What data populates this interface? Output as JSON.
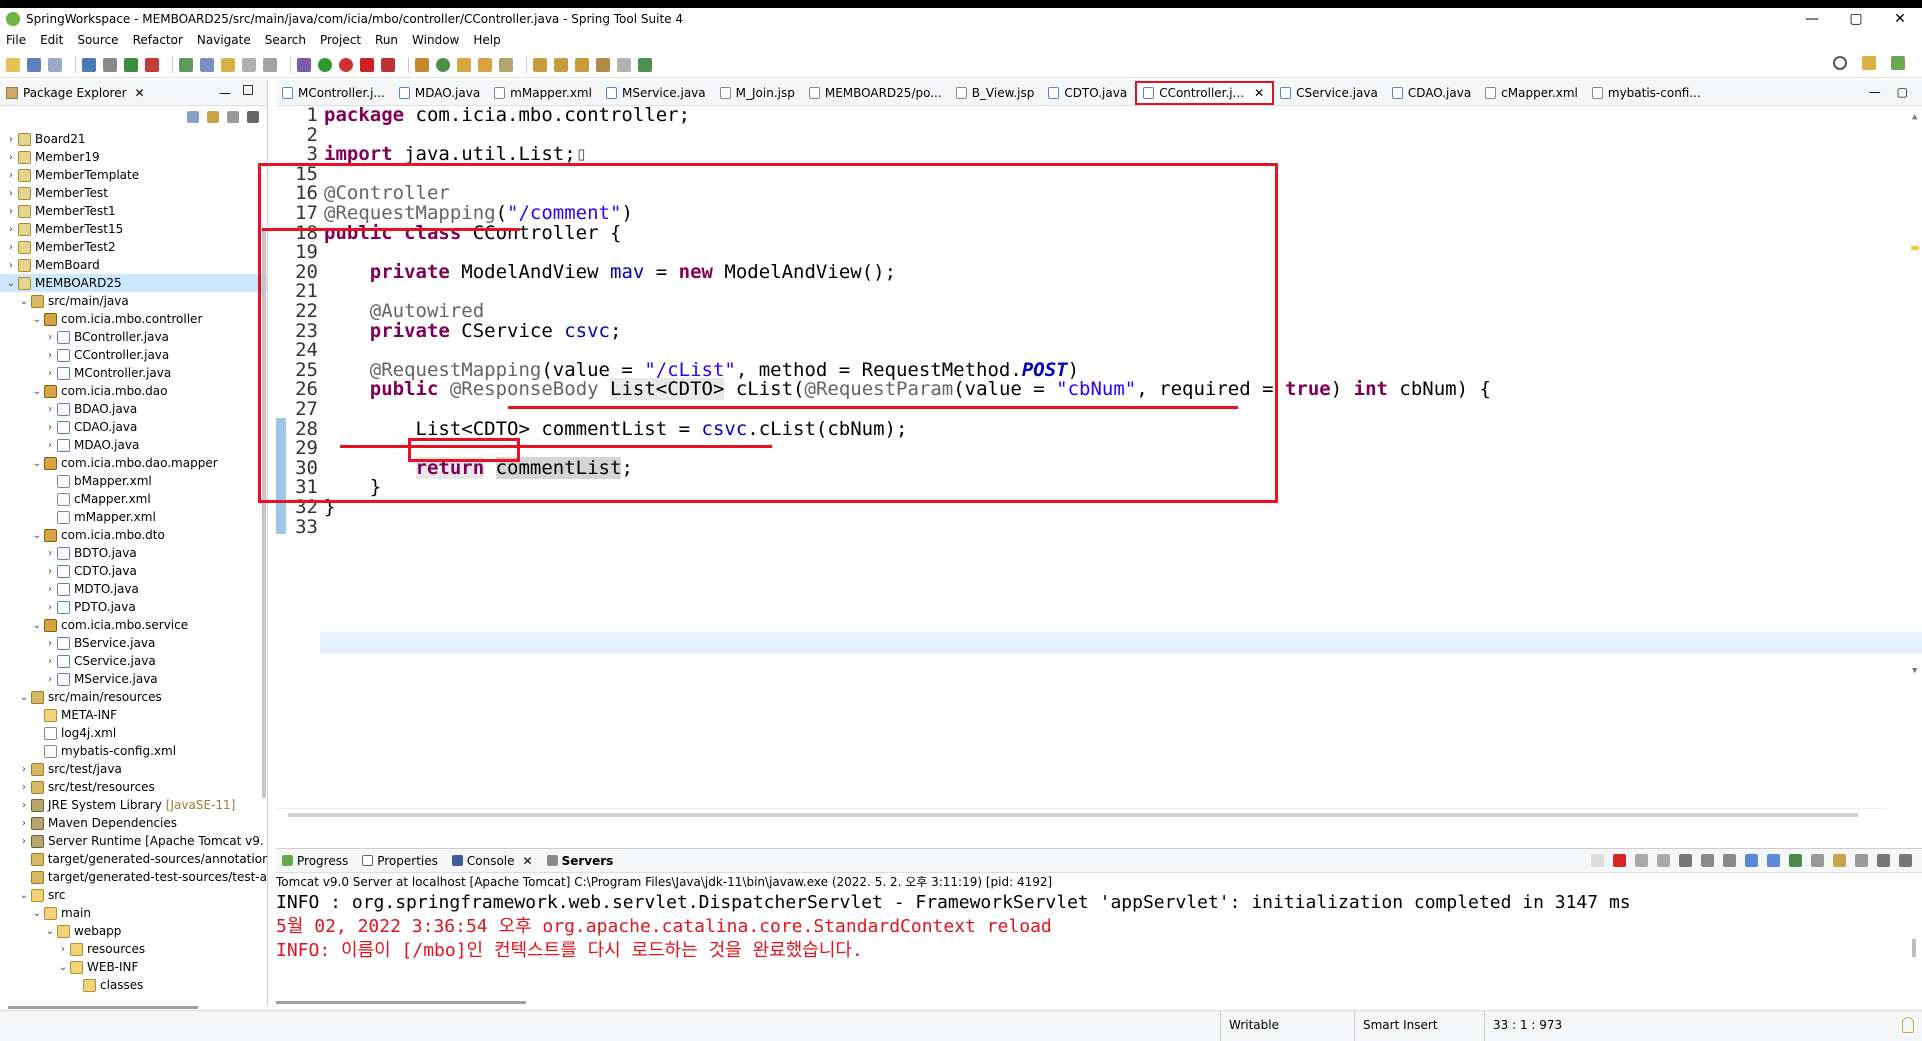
{
  "window": {
    "title": "SpringWorkspace - MEMBOARD25/src/main/java/com/icia/mbo/controller/CController.java - Spring Tool Suite 4",
    "minimize": "—",
    "maximize": "▢",
    "close": "✕"
  },
  "menu": [
    "File",
    "Edit",
    "Source",
    "Refactor",
    "Navigate",
    "Search",
    "Project",
    "Run",
    "Window",
    "Help"
  ],
  "package_explorer": {
    "tab_label": "Package Explorer",
    "tree": [
      {
        "label": "Board21",
        "icon": "project-icon",
        "twisty": "›",
        "indent": 0
      },
      {
        "label": "Member19",
        "icon": "project-icon",
        "twisty": "›",
        "indent": 0
      },
      {
        "label": "MemberTemplate",
        "icon": "project-icon",
        "twisty": "›",
        "indent": 0
      },
      {
        "label": "MemberTest",
        "icon": "project-icon",
        "twisty": "›",
        "indent": 0
      },
      {
        "label": "MemberTest1",
        "icon": "project-icon",
        "twisty": "›",
        "indent": 0
      },
      {
        "label": "MemberTest15",
        "icon": "project-icon",
        "twisty": "›",
        "indent": 0
      },
      {
        "label": "MemberTest2",
        "icon": "project-icon",
        "twisty": "›",
        "indent": 0
      },
      {
        "label": "MemBoard",
        "icon": "project-icon",
        "twisty": "›",
        "indent": 0
      },
      {
        "label": "MEMBOARD25",
        "icon": "project-icon",
        "twisty": "⌄",
        "indent": 0,
        "selected": true
      },
      {
        "label": "src/main/java",
        "icon": "source-folder-icon",
        "twisty": "⌄",
        "indent": 1
      },
      {
        "label": "com.icia.mbo.controller",
        "icon": "package-icon",
        "twisty": "⌄",
        "indent": 2
      },
      {
        "label": "BController.java",
        "icon": "java-file-icon",
        "twisty": "›",
        "indent": 3
      },
      {
        "label": "CController.java",
        "icon": "java-file-icon",
        "twisty": "›",
        "indent": 3
      },
      {
        "label": "MController.java",
        "icon": "java-file-icon",
        "twisty": "›",
        "indent": 3
      },
      {
        "label": "com.icia.mbo.dao",
        "icon": "package-icon",
        "twisty": "⌄",
        "indent": 2
      },
      {
        "label": "BDAO.java",
        "icon": "java-file-icon",
        "twisty": "›",
        "indent": 3
      },
      {
        "label": "CDAO.java",
        "icon": "java-file-icon",
        "twisty": "›",
        "indent": 3
      },
      {
        "label": "MDAO.java",
        "icon": "java-file-icon",
        "twisty": "›",
        "indent": 3
      },
      {
        "label": "com.icia.mbo.dao.mapper",
        "icon": "package-icon",
        "twisty": "⌄",
        "indent": 2
      },
      {
        "label": "bMapper.xml",
        "icon": "xml-file-icon",
        "twisty": "",
        "indent": 3
      },
      {
        "label": "cMapper.xml",
        "icon": "xml-file-icon",
        "twisty": "",
        "indent": 3
      },
      {
        "label": "mMapper.xml",
        "icon": "xml-file-icon",
        "twisty": "",
        "indent": 3
      },
      {
        "label": "com.icia.mbo.dto",
        "icon": "package-icon",
        "twisty": "⌄",
        "indent": 2
      },
      {
        "label": "BDTO.java",
        "icon": "java-file-icon",
        "twisty": "›",
        "indent": 3
      },
      {
        "label": "CDTO.java",
        "icon": "java-file-icon",
        "twisty": "›",
        "indent": 3
      },
      {
        "label": "MDTO.java",
        "icon": "java-file-icon",
        "twisty": "›",
        "indent": 3
      },
      {
        "label": "PDTO.java",
        "icon": "java-file-icon",
        "twisty": "›",
        "indent": 3
      },
      {
        "label": "com.icia.mbo.service",
        "icon": "package-icon",
        "twisty": "⌄",
        "indent": 2
      },
      {
        "label": "BService.java",
        "icon": "java-file-icon",
        "twisty": "›",
        "indent": 3
      },
      {
        "label": "CService.java",
        "icon": "java-file-icon",
        "twisty": "›",
        "indent": 3
      },
      {
        "label": "MService.java",
        "icon": "java-file-icon",
        "twisty": "›",
        "indent": 3
      },
      {
        "label": "src/main/resources",
        "icon": "source-folder-icon",
        "twisty": "⌄",
        "indent": 1
      },
      {
        "label": "META-INF",
        "icon": "folder-icon",
        "twisty": "",
        "indent": 2
      },
      {
        "label": "log4j.xml",
        "icon": "xml-file-icon",
        "twisty": "",
        "indent": 2
      },
      {
        "label": "mybatis-config.xml",
        "icon": "xml-file-icon",
        "twisty": "",
        "indent": 2
      },
      {
        "label": "src/test/java",
        "icon": "source-folder-icon",
        "twisty": "›",
        "indent": 1
      },
      {
        "label": "src/test/resources",
        "icon": "source-folder-icon",
        "twisty": "›",
        "indent": 1
      },
      {
        "label": "JRE System Library",
        "extra": "[JavaSE-11]",
        "icon": "library-icon",
        "twisty": "›",
        "indent": 1
      },
      {
        "label": "Maven Dependencies",
        "icon": "library-icon",
        "twisty": "›",
        "indent": 1
      },
      {
        "label": "Server Runtime [Apache Tomcat v9.",
        "icon": "library-icon",
        "twisty": "›",
        "indent": 1
      },
      {
        "label": "target/generated-sources/annotatior",
        "icon": "source-folder-icon",
        "twisty": "",
        "indent": 1
      },
      {
        "label": "target/generated-test-sources/test-a",
        "icon": "source-folder-icon",
        "twisty": "",
        "indent": 1
      },
      {
        "label": "src",
        "icon": "folder-icon",
        "twisty": "⌄",
        "indent": 1
      },
      {
        "label": "main",
        "icon": "folder-icon",
        "twisty": "⌄",
        "indent": 2
      },
      {
        "label": "webapp",
        "icon": "folder-icon",
        "twisty": "⌄",
        "indent": 3
      },
      {
        "label": "resources",
        "icon": "folder-icon",
        "twisty": "›",
        "indent": 4
      },
      {
        "label": "WEB-INF",
        "icon": "folder-icon",
        "twisty": "⌄",
        "indent": 4
      },
      {
        "label": "classes",
        "icon": "folder-icon",
        "twisty": "",
        "indent": 5
      }
    ]
  },
  "editor_tabs": [
    {
      "label": "MController.j...",
      "icon": "java-file-icon"
    },
    {
      "label": "MDAO.java",
      "icon": "java-file-icon"
    },
    {
      "label": "mMapper.xml",
      "icon": "xml-file-icon"
    },
    {
      "label": "MService.java",
      "icon": "java-file-icon"
    },
    {
      "label": "M_Join.jsp",
      "icon": "jsp-file-icon"
    },
    {
      "label": "MEMBOARD25/po...",
      "icon": "xml-file-icon"
    },
    {
      "label": "B_View.jsp",
      "icon": "jsp-file-icon"
    },
    {
      "label": "CDTO.java",
      "icon": "java-file-icon"
    },
    {
      "label": "CController.j...",
      "icon": "java-file-icon",
      "active": true
    },
    {
      "label": "CService.java",
      "icon": "java-file-icon"
    },
    {
      "label": "CDAO.java",
      "icon": "java-file-icon"
    },
    {
      "label": "cMapper.xml",
      "icon": "xml-file-icon"
    },
    {
      "label": "mybatis-confi...",
      "icon": "xml-file-icon"
    }
  ],
  "code": {
    "line_numbers": [
      "1",
      "2",
      "3",
      "15",
      "16",
      "17",
      "18",
      "19",
      "20",
      "21",
      "22",
      "23",
      "24",
      "25",
      "26",
      "27",
      "28",
      "29",
      "30",
      "31",
      "32",
      "33"
    ],
    "lines": [
      [
        {
          "t": "package",
          "c": "kw"
        },
        {
          "t": " com.icia.mbo.controller;"
        }
      ],
      [],
      [
        {
          "t": "import",
          "c": "kw"
        },
        {
          "t": " java.util.List;"
        },
        {
          "t": "▯",
          "c": "ann"
        }
      ],
      [],
      [
        {
          "t": "@Controller",
          "c": "ann"
        }
      ],
      [
        {
          "t": "@RequestMapping",
          "c": "ann"
        },
        {
          "t": "("
        },
        {
          "t": "\"/comment\"",
          "c": "str"
        },
        {
          "t": ")"
        }
      ],
      [
        {
          "t": "public",
          "c": "kw"
        },
        {
          "t": " "
        },
        {
          "t": "class",
          "c": "kw"
        },
        {
          "t": " CController {"
        }
      ],
      [],
      [
        {
          "t": "    "
        },
        {
          "t": "private",
          "c": "kw"
        },
        {
          "t": " ModelAndView "
        },
        {
          "t": "mav",
          "c": "fld"
        },
        {
          "t": " = "
        },
        {
          "t": "new",
          "c": "kw"
        },
        {
          "t": " ModelAndView();"
        }
      ],
      [],
      [
        {
          "t": "    "
        },
        {
          "t": "@Autowired",
          "c": "ann"
        }
      ],
      [
        {
          "t": "    "
        },
        {
          "t": "private",
          "c": "kw"
        },
        {
          "t": " CService "
        },
        {
          "t": "csvc",
          "c": "fld"
        },
        {
          "t": ";"
        }
      ],
      [],
      [
        {
          "t": "    "
        },
        {
          "t": "@RequestMapping",
          "c": "ann"
        },
        {
          "t": "(value = "
        },
        {
          "t": "\"/cList\"",
          "c": "str"
        },
        {
          "t": ", method = RequestMethod."
        },
        {
          "t": "POST",
          "c": "itl"
        },
        {
          "t": ")"
        }
      ],
      [
        {
          "t": "    "
        },
        {
          "t": "public",
          "c": "kw"
        },
        {
          "t": " "
        },
        {
          "t": "@ResponseBody",
          "c": "ann"
        },
        {
          "t": " "
        },
        {
          "t": "List<CDTO>",
          "c": "hl"
        },
        {
          "t": " cList("
        },
        {
          "t": "@RequestParam",
          "c": "ann"
        },
        {
          "t": "(value = "
        },
        {
          "t": "\"cbNum\"",
          "c": "str"
        },
        {
          "t": ", required = "
        },
        {
          "t": "true",
          "c": "kw"
        },
        {
          "t": ") "
        },
        {
          "t": "int",
          "c": "kw"
        },
        {
          "t": " cbNum) {"
        }
      ],
      [],
      [
        {
          "t": "        List<CDTO> commentList = "
        },
        {
          "t": "csvc",
          "c": "fld"
        },
        {
          "t": ".cList(cbNum);"
        }
      ],
      [],
      [
        {
          "t": "        "
        },
        {
          "t": "return",
          "c": "kw hl"
        },
        {
          "t": " "
        },
        {
          "t": "commentList",
          "c": "hl2"
        },
        {
          "t": ";"
        }
      ],
      [
        {
          "t": "    }"
        }
      ],
      [
        {
          "t": "}"
        }
      ],
      []
    ]
  },
  "console": {
    "tabs": [
      "Progress",
      "Properties",
      "Console",
      "Servers"
    ],
    "description": "Tomcat v9.0 Server at localhost [Apache Tomcat] C:\\Program Files\\Java\\jdk-11\\bin\\javaw.exe  (2022. 5. 2. 오후 3:11:19) [pid: 4192]",
    "lines": [
      {
        "text": "INFO : org.springframework.web.servlet.DispatcherServlet - FrameworkServlet 'appServlet': initialization completed in 3147 ms",
        "kind": "info"
      },
      {
        "text": "5월 02, 2022 3:36:54 오후 org.apache.catalina.core.StandardContext reload",
        "kind": "err"
      },
      {
        "text": "INFO: 이름이 [/mbo]인 컨텍스트를 다시 로드하는 것을 완료했습니다.",
        "kind": "err"
      }
    ]
  },
  "status": {
    "writable": "Writable",
    "insert_mode": "Smart Insert",
    "position": "33 : 1 : 973"
  },
  "colors": {
    "keyword": "#7f0055",
    "annotation": "#646464",
    "string": "#2a00ff",
    "field": "#0000c0",
    "highlight_red": "#e81123",
    "console_error": "#e0141e",
    "selection": "#cce8ff"
  }
}
